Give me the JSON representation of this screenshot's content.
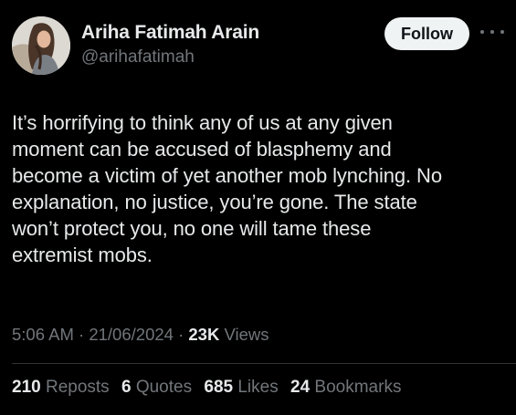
{
  "author": {
    "name": "Ariha Fatimah Arain",
    "handle": "@arihafatimah"
  },
  "actions": {
    "follow_label": "Follow",
    "more_icon": "more-horizontal-icon"
  },
  "tweet": {
    "lines": [
      "It’s horrifying to think any of us at any given",
      "moment can be accused of blasphemy and",
      "become a victim of yet another mob lynching. No",
      "explanation, no justice, you’re gone. The state",
      "won’t protect you, no one will tame these",
      "extremist mobs."
    ],
    "time": "5:06 AM",
    "date": "21/06/2024",
    "views_count": "23K",
    "views_label": "Views"
  },
  "stats": {
    "reposts_count": "210",
    "reposts_label": "Reposts",
    "quotes_count": "6",
    "quotes_label": "Quotes",
    "likes_count": "685",
    "likes_label": "Likes",
    "bookmarks_count": "24",
    "bookmarks_label": "Bookmarks"
  },
  "colors": {
    "background": "#000000",
    "primary_text": "#e7e9ea",
    "secondary_text": "#71767b",
    "follow_button_bg": "#eff3f4",
    "divider": "#2f3336"
  }
}
